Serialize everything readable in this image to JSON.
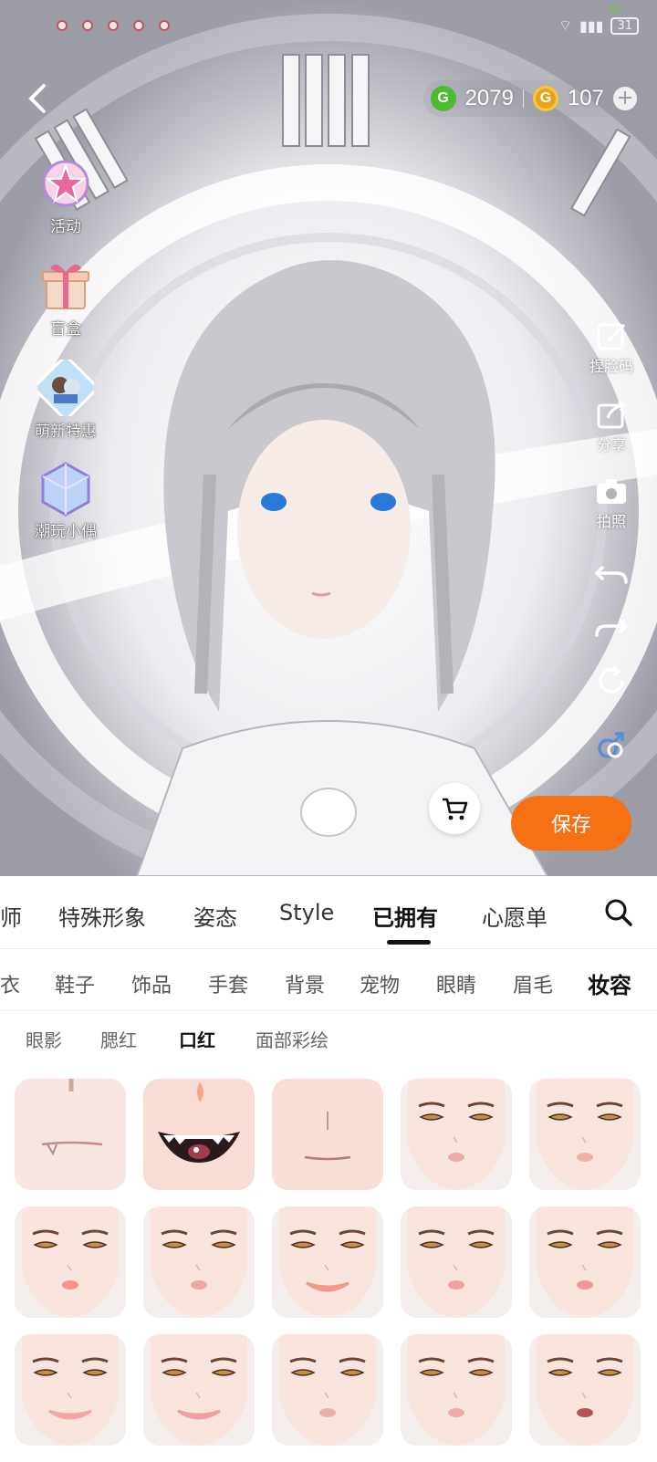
{
  "status": {
    "net_speed": "50",
    "battery": "31"
  },
  "header": {
    "currency_green": "2079",
    "currency_gold": "107"
  },
  "left_menu": [
    {
      "label": "活动",
      "icon": "star-badge-icon"
    },
    {
      "label": "盲盒",
      "icon": "gift-box-icon"
    },
    {
      "label": "萌新特惠",
      "icon": "character-card-icon"
    },
    {
      "label": "潮玩小偶",
      "icon": "crystal-cube-icon"
    }
  ],
  "right_tools": [
    {
      "label": "捏脸码",
      "icon": "face-code-icon"
    },
    {
      "label": "分享",
      "icon": "share-icon"
    },
    {
      "label": "拍照",
      "icon": "camera-icon"
    },
    {
      "label": "",
      "icon": "undo-icon"
    },
    {
      "label": "",
      "icon": "redo-icon"
    },
    {
      "label": "",
      "icon": "reset-icon"
    },
    {
      "label": "",
      "icon": "gender-switch-icon"
    }
  ],
  "actions": {
    "save_label": "保存"
  },
  "tabs_level1": [
    "师",
    "特殊形象",
    "姿态",
    "Style",
    "已拥有",
    "心愿单"
  ],
  "tabs_level1_active": "已拥有",
  "tabs_level2": [
    "衣",
    "鞋子",
    "饰品",
    "手套",
    "背景",
    "宠物",
    "眼睛",
    "眉毛",
    "妆容"
  ],
  "tabs_level2_active": "妆容",
  "tabs_level3": [
    "眼影",
    "腮红",
    "口红",
    "面部彩绘"
  ],
  "tabs_level3_active": "口红",
  "colors": {
    "accent": "#f57114",
    "coin_green": "#4cbb2f",
    "coin_gold": "#e7a41a"
  },
  "lipstick_items": [
    {
      "type": "closeup-drip"
    },
    {
      "type": "closeup-fangs"
    },
    {
      "type": "closeup-plain"
    },
    {
      "type": "face",
      "lip": "#f0a8a6"
    },
    {
      "type": "face",
      "lip": "#efb2ab"
    },
    {
      "type": "face",
      "lip": "#f2958f"
    },
    {
      "type": "face",
      "lip": "#f0a6a4"
    },
    {
      "type": "face",
      "lip": "#f2998c",
      "smile": true
    },
    {
      "type": "face",
      "lip": "#f2a0a0"
    },
    {
      "type": "face",
      "lip": "#ee9a98"
    },
    {
      "type": "face",
      "lip": "#f3a4a4",
      "smile": true
    },
    {
      "type": "face",
      "lip": "#f0a0a4",
      "smile": true
    },
    {
      "type": "face",
      "lip": "#e9b1a8"
    },
    {
      "type": "face",
      "lip": "#f1a8aa"
    },
    {
      "type": "face",
      "lip": "#b8515a"
    }
  ]
}
